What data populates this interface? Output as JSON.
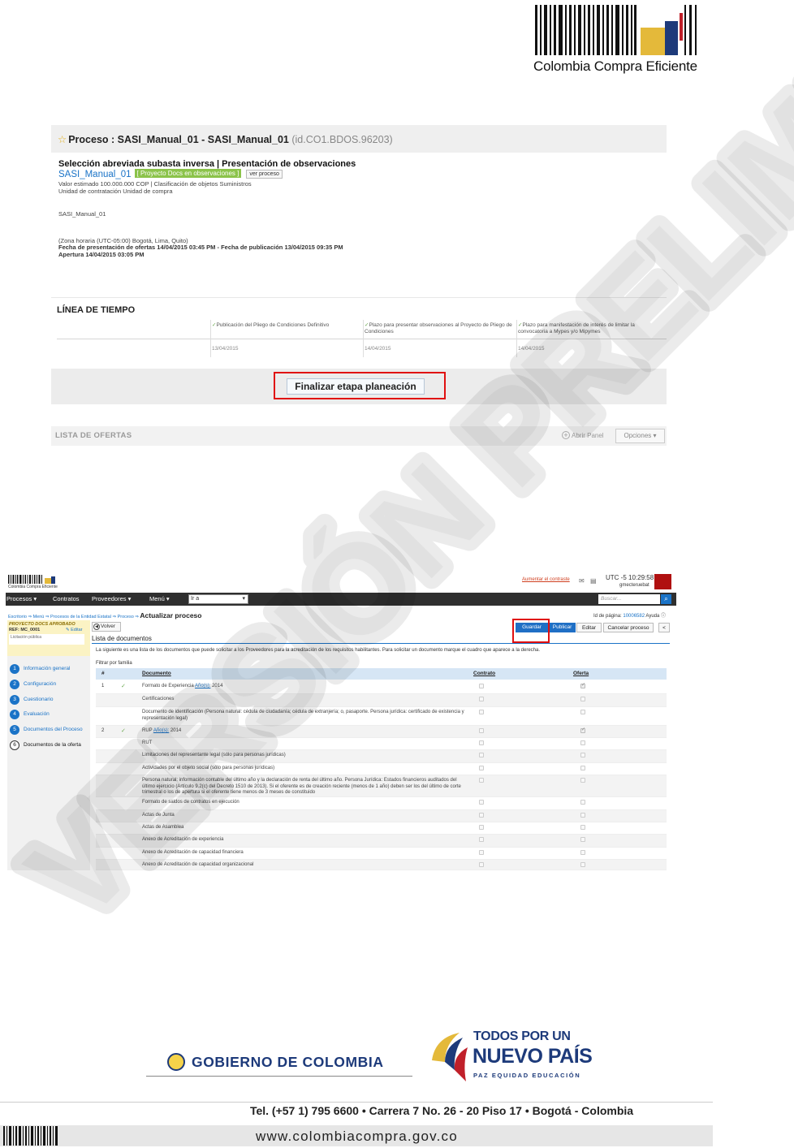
{
  "header": {
    "logo_text": "Colombia Compra Eficiente"
  },
  "screen1": {
    "title_prefix": "Proceso : SASI_Manual_01 - SASI_Manual_01",
    "title_id": "(id.CO1.BDOS.96203)",
    "heading": "Selección abreviada subasta inversa | Presentación de observaciones",
    "process_name": "SASI_Manual_01",
    "status_tag": "[ Proyecto Docs en observaciones ]",
    "ver_proceso": "ver proceso",
    "valor_line": "Valor estimado 100.000.000 COP | Clasificación de objetos  Suministros",
    "unidad_line": "Unidad de contratación Unidad de compra",
    "description": "SASI_Manual_01",
    "timezone": "(Zona horaria (UTC-05:00) Bogotá, Lima, Quito)",
    "fechas_line": "Fecha de presentación de ofertas 14/04/2015 03:45 PM - Fecha de publicación 13/04/2015 09:35 PM",
    "apertura_line": "Apertura 14/04/2015 03:05 PM",
    "timeline_title": "LÍNEA DE TIEMPO",
    "timeline": [
      {
        "label": "Publicación del Pliego de Condiciones Definitivo",
        "date": "13/04/2015"
      },
      {
        "label": "Plazo para presentar observaciones al Proyecto de Pliego de Condiciones",
        "date": "14/04/2015"
      },
      {
        "label": "Plazo para manifestación de interés de limitar la convocatoria a Mypes y/o Mipymes",
        "date": "14/04/2015"
      }
    ],
    "finalizar_button": "Finalizar etapa planeación"
  },
  "offers_bar": {
    "label": "LISTA DE OFERTAS",
    "abrir_panel": "Abrir Panel",
    "opciones": "Opciones ▾"
  },
  "screen2": {
    "top": {
      "logo_text": "Colombia Compra Eficiente",
      "aumentar": "Aumentar el contraste",
      "utc": "UTC -5 10:29:58",
      "user": "gmecteruebat"
    },
    "nav": {
      "items": [
        "Procesos ▾",
        "Contratos",
        "Proveedores ▾",
        "Menú ▾"
      ],
      "ir_a": "Ir a",
      "search_placeholder": "Buscar..."
    },
    "breadcrumb": "Escritorio ⇒ Menú ⇒ Procesos de la Entidad Estatal ⇒ Proceso ⇒ ",
    "breadcrumb_current": "Actualizar proceso",
    "id_pagina_label": "Id de página: ",
    "id_pagina_value": "10006582",
    "ayuda": "Ayuda ⓘ",
    "sidebar": {
      "status": "PROYECTO DOCS APROBADO",
      "ref": "REF: MC_0001",
      "editar": "✎ Editar",
      "note": "Licitación pública",
      "steps": [
        {
          "num": "1",
          "label": "Información general"
        },
        {
          "num": "2",
          "label": "Configuración"
        },
        {
          "num": "3",
          "label": "Cuestionario"
        },
        {
          "num": "4",
          "label": "Evaluación"
        },
        {
          "num": "5",
          "label": "Documentos del Proceso"
        },
        {
          "num": "6",
          "label": "Documentos de la oferta"
        }
      ]
    },
    "buttons": {
      "volver": "Volver",
      "guardar": "Guardar",
      "publicar": "Publicar",
      "editar": "Editar",
      "cancelar": "Cancelar proceso",
      "prev": "<"
    },
    "list_title": "Lista de documentos",
    "intro": "La siguiente es una lista de los documentos que puede solicitar a los Proveedores para la acreditación de los requisitos habilitantes. Para solicitar un documento marque el cuadro que aparece a la derecha.",
    "filtro": "Filtrar por familia",
    "columns": {
      "num": "#",
      "documento": "Documento",
      "contrato": "Contrato",
      "oferta": "Oferta"
    },
    "rows": [
      {
        "num": "1",
        "check": true,
        "doc": "Formato de Experiencia",
        "link": "Año(s):",
        "extra": " 2014",
        "oferta": true
      },
      {
        "num": "",
        "check": false,
        "doc": "Certificaciones",
        "link": "",
        "extra": "",
        "oferta": false
      },
      {
        "num": "",
        "check": false,
        "doc": "Documento de identificación (Persona natural: cédula de ciudadanía; cédula de extranjería; o, pasaporte. Persona jurídica: certificado de existencia y representación legal)",
        "link": "",
        "extra": "",
        "oferta": false
      },
      {
        "num": "2",
        "check": true,
        "doc": "RUP",
        "link": "Año(s):",
        "extra": " 2014",
        "oferta": true
      },
      {
        "num": "",
        "check": false,
        "doc": "RUT",
        "link": "",
        "extra": "",
        "oferta": false
      },
      {
        "num": "",
        "check": false,
        "doc": "Limitaciones del representante legal (sólo para personas jurídicas)",
        "link": "",
        "extra": "",
        "oferta": false
      },
      {
        "num": "",
        "check": false,
        "doc": "Actividades por el objeto social (sólo para personas jurídicas)",
        "link": "",
        "extra": "",
        "oferta": false
      },
      {
        "num": "",
        "check": false,
        "doc": "Persona natural: información contable del último año y la declaración de renta del último año. Persona Jurídica: Estados financieros auditados del último ejercicio (Artículo 9.2(c) del Decreto 1510 de 2013). Si el oferente es de creación reciente (menos de 1 año) deben ser los del último de corte trimestral o los de apertura si el oferente tiene menos de 3 meses de constituido",
        "link": "",
        "extra": "",
        "oferta": false
      },
      {
        "num": "",
        "check": false,
        "doc": "Formato de saldos de contratos en ejecución",
        "link": "",
        "extra": "",
        "oferta": false
      },
      {
        "num": "",
        "check": false,
        "doc": "Actas de Junta",
        "link": "",
        "extra": "",
        "oferta": false
      },
      {
        "num": "",
        "check": false,
        "doc": "Actas de Asamblea",
        "link": "",
        "extra": "",
        "oferta": false
      },
      {
        "num": "",
        "check": false,
        "doc": "Anexo de Acreditación de experiencia",
        "link": "",
        "extra": "",
        "oferta": false
      },
      {
        "num": "",
        "check": false,
        "doc": "Anexo de Acreditación de capacidad financiera",
        "link": "",
        "extra": "",
        "oferta": false
      },
      {
        "num": "",
        "check": false,
        "doc": "Anexo de Acreditación de capacidad organizacional",
        "link": "",
        "extra": "",
        "oferta": false
      }
    ]
  },
  "watermark": {
    "text": "VERSIÓN PRELIMINAR",
    "color": "#000000"
  },
  "footer": {
    "gobierno": "GOBIERNO DE COLOMBIA",
    "todos_l1": "TODOS POR UN",
    "todos_l2": "NUEVO PAÍS",
    "todos_l3": "PAZ  EQUIDAD  EDUCACIÓN",
    "contact": "Tel. (+57 1) 795 6600 • Carrera 7 No. 26 - 20 Piso 17 • Bogotá - Colombia",
    "url": "www.colombiacompra.gov.co"
  },
  "colors": {
    "accent_blue": "#1a73c7",
    "highlight_red": "#e01010",
    "brand_navy": "#1d3a7a",
    "brand_yellow": "#e4b93a"
  }
}
